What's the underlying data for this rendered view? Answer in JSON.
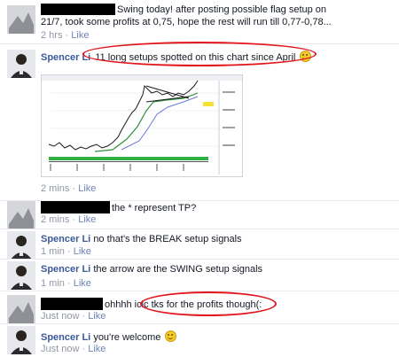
{
  "comments": [
    {
      "id": "c1",
      "author": "",
      "text": "Swing today! after posting possible flag setup on 21/7, took some profits at 0,75, hope the rest will run till 0,77-0,78...",
      "time": "2 hrs",
      "like": "Like"
    },
    {
      "id": "c2",
      "author": "Spencer Li",
      "text": "11 long setups spotted on this chart since April",
      "time": "2 mins",
      "like": "Like"
    },
    {
      "id": "c3",
      "author": "",
      "text": "the * represent TP?",
      "time": "2 mins",
      "like": "Like"
    },
    {
      "id": "c4",
      "author": "Spencer Li",
      "text": "no that's the BREAK setup signals",
      "time": "1 min",
      "like": "Like"
    },
    {
      "id": "c5",
      "author": "Spencer Li",
      "text": "the arrow are the SWING setup signals",
      "time": "1 min",
      "like": "Like"
    },
    {
      "id": "c6",
      "author": "",
      "text": "ohhhh icic tks for the profits though(:",
      "time": "Just now",
      "like": "Like"
    },
    {
      "id": "c7",
      "author": "Spencer Li",
      "text": "you're welcome",
      "time": "Just now",
      "like": "Like"
    }
  ],
  "separator": "·",
  "colors": {
    "link": "#3b5998",
    "meta": "#9197a3",
    "annotation": "#e3151c",
    "uptrend": "#3a8f3a"
  }
}
